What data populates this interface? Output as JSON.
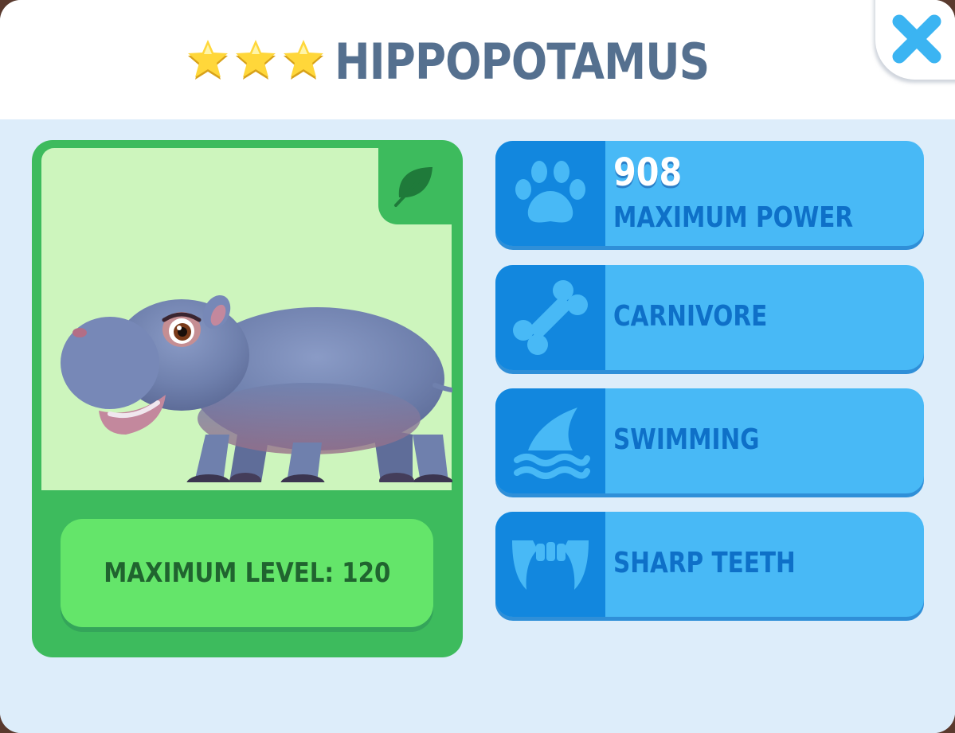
{
  "header": {
    "stars": 3,
    "title": "HIPPOPOTAMUS"
  },
  "card": {
    "max_level": "MAXIMUM LEVEL: 120",
    "diet_icon": "leaf-icon"
  },
  "stats": [
    {
      "icon": "paw-icon",
      "value": "908",
      "label": "MAXIMUM POWER"
    },
    {
      "icon": "bone-icon",
      "label": "CARNIVORE"
    },
    {
      "icon": "shark-fin-icon",
      "label": "SWIMMING"
    },
    {
      "icon": "fangs-icon",
      "label": "SHARP TEETH"
    }
  ],
  "colors": {
    "title": "#55708f",
    "card_green": "#3dbb5d",
    "stat_blue": "#48b9f6",
    "icon_blue": "#1287de",
    "close_blue": "#3bb4f2"
  }
}
